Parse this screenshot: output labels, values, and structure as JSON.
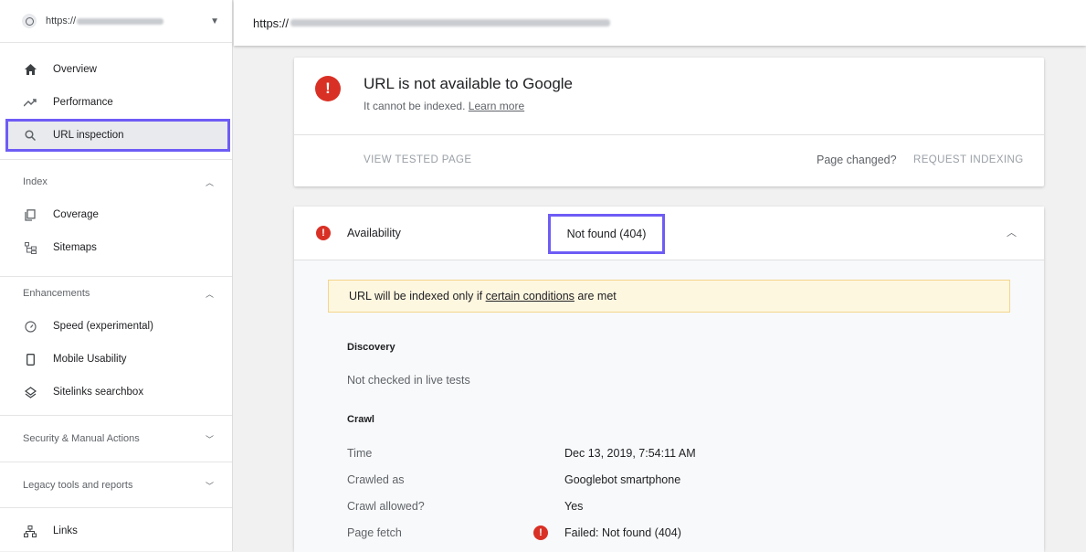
{
  "sidebar": {
    "property_prefix": "https://",
    "items_top": [
      {
        "label": "Overview",
        "icon": "home-icon"
      },
      {
        "label": "Performance",
        "icon": "trending-up-icon"
      },
      {
        "label": "URL inspection",
        "icon": "search-icon"
      }
    ],
    "index_header": "Index",
    "index_items": [
      {
        "label": "Coverage",
        "icon": "coverage-icon"
      },
      {
        "label": "Sitemaps",
        "icon": "sitemap-icon"
      }
    ],
    "enhancements_header": "Enhancements",
    "enhancements_items": [
      {
        "label": "Speed (experimental)",
        "icon": "speedometer-icon"
      },
      {
        "label": "Mobile Usability",
        "icon": "phone-icon"
      },
      {
        "label": "Sitelinks searchbox",
        "icon": "layers-icon"
      }
    ],
    "security_header": "Security & Manual Actions",
    "legacy_header": "Legacy tools and reports",
    "links_label": "Links"
  },
  "topbar": {
    "url_prefix": "https://"
  },
  "status_card": {
    "title": "URL is not available to Google",
    "subtitle_prefix": "It cannot be indexed.",
    "learn_more": "Learn more",
    "view_tested_page": "VIEW TESTED PAGE",
    "page_changed": "Page changed?",
    "request_indexing": "REQUEST INDEXING"
  },
  "availability": {
    "label": "Availability",
    "value": "Not found (404)",
    "banner_prefix": "URL will be indexed only if",
    "banner_link": "certain conditions",
    "banner_suffix": "are met",
    "discovery_heading": "Discovery",
    "discovery_text": "Not checked in live tests",
    "crawl_heading": "Crawl",
    "crawl_rows": [
      {
        "key": "Time",
        "value": "Dec 13, 2019, 7:54:11 AM"
      },
      {
        "key": "Crawled as",
        "value": "Googlebot smartphone"
      },
      {
        "key": "Crawl allowed?",
        "value": "Yes"
      },
      {
        "key": "Page fetch",
        "value": "Failed: Not found (404)"
      }
    ]
  },
  "colors": {
    "error": "#d93025",
    "highlight": "#6e5cf5",
    "banner_bg": "#fef7e0"
  }
}
